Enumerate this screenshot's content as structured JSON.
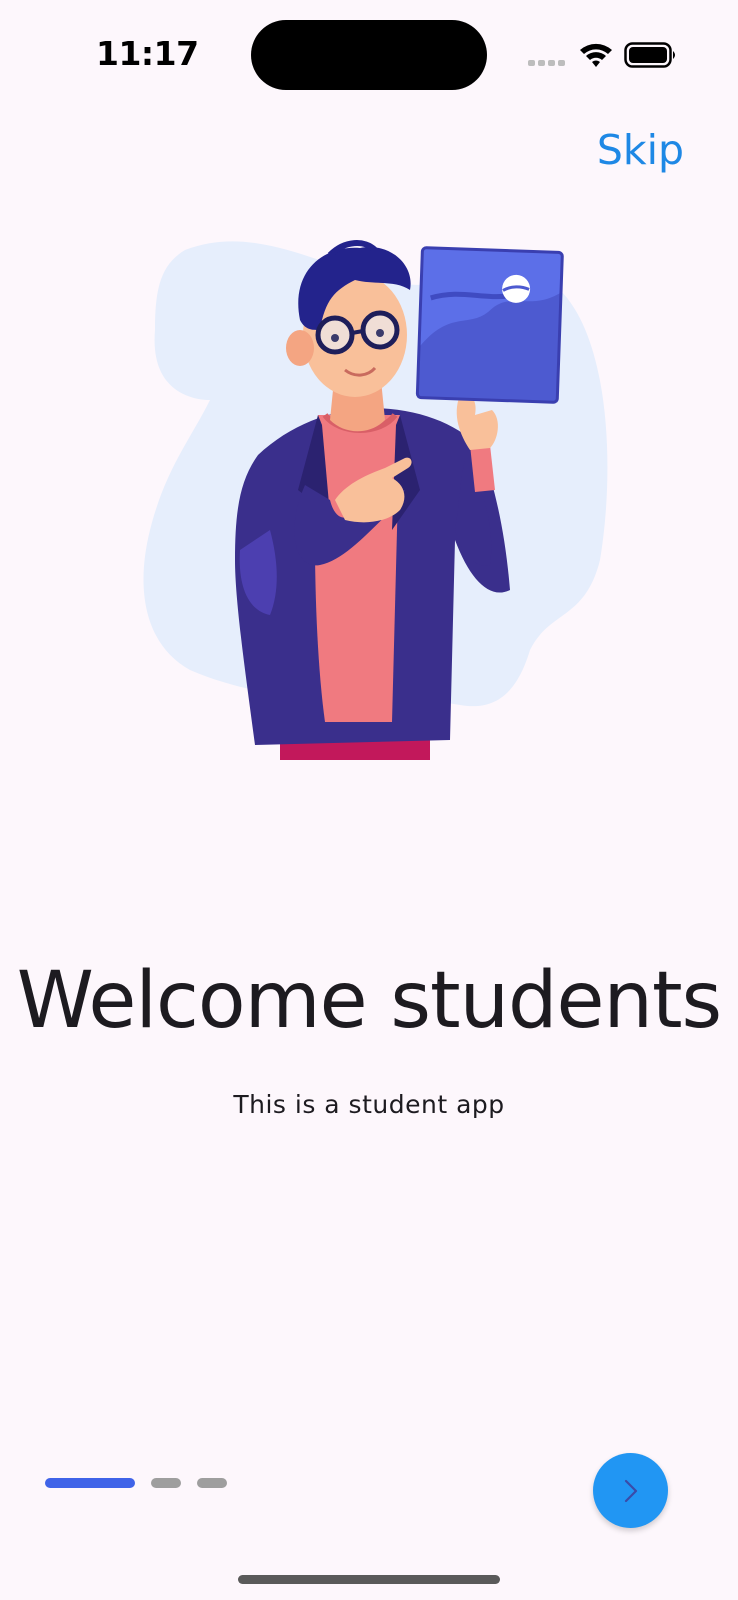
{
  "status_bar": {
    "time": "11:17",
    "icons": [
      "cellular-signal-icon",
      "wifi-icon",
      "battery-icon"
    ]
  },
  "onboarding": {
    "skip_label": "Skip",
    "title": "Welcome students",
    "subtitle": "This is a student app",
    "page_count": 3,
    "current_page": 1,
    "illustration": "student-holding-picture-illustration"
  },
  "colors": {
    "background": "#FDF7FC",
    "accent": "#2196F3",
    "skip_text": "#1E88E5",
    "active_indicator": "#3F63E8",
    "inactive_indicator": "#9E9E9E"
  },
  "next_button": {
    "icon": "chevron-right-icon"
  }
}
